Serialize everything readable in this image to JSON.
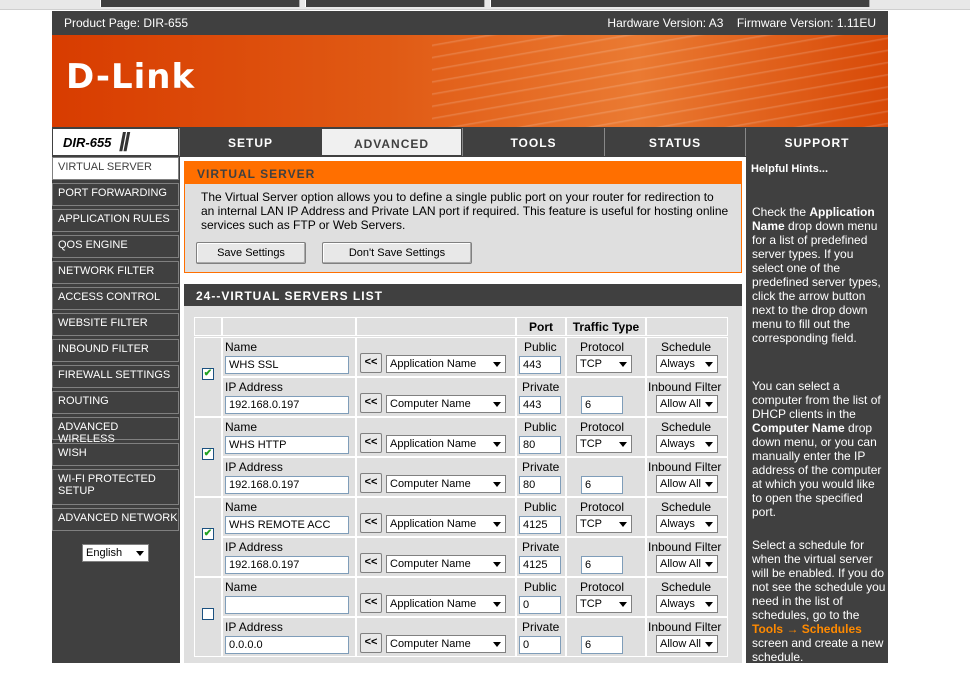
{
  "header": {
    "product_page": "Product Page: DIR-655",
    "hardware_version": "Hardware Version: A3",
    "firmware_version": "Firmware Version: 1.11EU",
    "logo": "D-Link",
    "model": "DIR-655"
  },
  "tabs": [
    "SETUP",
    "ADVANCED",
    "TOOLS",
    "STATUS",
    "SUPPORT"
  ],
  "sidebar": {
    "items": [
      "VIRTUAL SERVER",
      "PORT FORWARDING",
      "APPLICATION RULES",
      "QOS ENGINE",
      "NETWORK FILTER",
      "ACCESS CONTROL",
      "WEBSITE FILTER",
      "INBOUND FILTER",
      "FIREWALL SETTINGS",
      "ROUTING",
      "ADVANCED WIRELESS",
      "WISH",
      "WI-FI PROTECTED SETUP",
      "ADVANCED NETWORK"
    ],
    "language": "English"
  },
  "virtual_server": {
    "title": "VIRTUAL SERVER",
    "description": "The Virtual Server option allows you to define a single public port on your router for redirection to an internal LAN IP Address and Private LAN port if required. This feature is useful for hosting online services such as FTP or Web Servers.",
    "save_label": "Save Settings",
    "dont_save_label": "Don't Save Settings"
  },
  "list": {
    "title": "24--VIRTUAL SERVERS LIST",
    "col_port": "Port",
    "col_traffic": "Traffic Type",
    "labels": {
      "name": "Name",
      "ip": "IP Address",
      "public": "Public",
      "private": "Private",
      "protocol": "Protocol",
      "schedule": "Schedule",
      "inbound": "Inbound Filter",
      "arrow": "<<"
    },
    "rows": [
      {
        "checked": "✔",
        "name": "WHS SSL",
        "app": "Application Name",
        "public_port": "443",
        "protocol": "TCP",
        "schedule": "Always",
        "ip": "192.168.0.197",
        "computer": "Computer Name",
        "private_port": "443",
        "proto_num": "6",
        "inbound": "Allow All"
      },
      {
        "checked": "✔",
        "name": "WHS HTTP",
        "app": "Application Name",
        "public_port": "80",
        "protocol": "TCP",
        "schedule": "Always",
        "ip": "192.168.0.197",
        "computer": "Computer Name",
        "private_port": "80",
        "proto_num": "6",
        "inbound": "Allow All"
      },
      {
        "checked": "✔",
        "name": "WHS REMOTE ACC",
        "app": "Application Name",
        "public_port": "4125",
        "protocol": "TCP",
        "schedule": "Always",
        "ip": "192.168.0.197",
        "computer": "Computer Name",
        "private_port": "4125",
        "proto_num": "6",
        "inbound": "Allow All"
      },
      {
        "checked": "",
        "name": "",
        "app": "Application Name",
        "public_port": "0",
        "protocol": "TCP",
        "schedule": "Always",
        "ip": "0.0.0.0",
        "computer": "Computer Name",
        "private_port": "0",
        "proto_num": "6",
        "inbound": "Allow All"
      }
    ]
  },
  "hints": {
    "title": "Helpful Hints...",
    "p1_a": "Check the ",
    "p1_b": "Application Name",
    "p1_c": " drop down menu for a list of predefined server types. If you select one of the predefined server types, click the arrow button next to the drop down menu to fill out the corresponding field.",
    "p2_a": "You can select a computer from the list of DHCP clients in the ",
    "p2_b": "Computer Name",
    "p2_c": " drop down menu, or you can manually enter the IP address of the computer at which you would like to open the specified port.",
    "p3_a": "Select a schedule for when the virtual server will be enabled. If you do not see the schedule you need in the list of schedules, go to the ",
    "p3_link": "Tools → Schedules",
    "p3_c": " screen and create a new schedule."
  }
}
